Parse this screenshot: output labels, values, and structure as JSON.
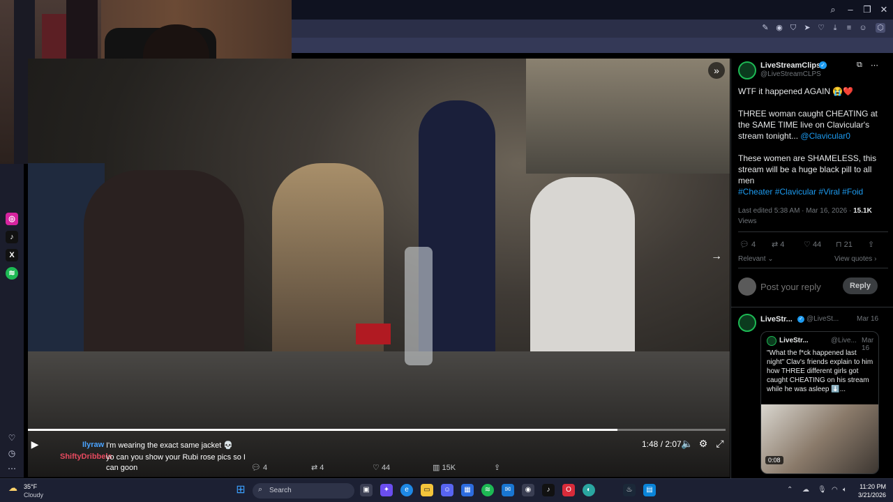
{
  "colors": {
    "accent_blue": "#1d9bf0",
    "progress": "#ffffff",
    "spotify_green": "#1db954"
  },
  "window_controls": {
    "search_icon": "search-icon",
    "minimize": "minimize-icon",
    "maximize": "maximize-icon",
    "close": "close-icon"
  },
  "video": {
    "time": "1:48 / 2:07",
    "progress": 0.845,
    "actions": {
      "replies": "4",
      "reposts": "4",
      "likes": "44",
      "views": "15K"
    }
  },
  "chat": [
    {
      "user": "Ilyraw",
      "user_color": "#4aa3ff",
      "message": "I'm wearing the exact same jacket 💀"
    },
    {
      "user": "ShiftyDribbels",
      "user_color": "#e84a5f",
      "message": "yo can you show your Rubi rose pics so I can goon"
    }
  ],
  "tweet": {
    "author_name": "LiveStreamClips",
    "author_handle": "@LiveStreamCLPS",
    "line1": "WTF it happened AGAIN 😭❤️",
    "para2": "THREE woman caught CHEATING at the SAME TIME live on Clavicular's stream tonight...",
    "mention": "@Clavicular0",
    "para3": "These women are SHAMELESS, this stream will be a huge black pill to all men",
    "hashtags": "#Cheater #Clavicular #Viral #Foid",
    "edited": "Last edited 5:38 AM · Mar 16, 2026 ·",
    "views_count": "15.1K",
    "views_label": "Views",
    "stats": {
      "replies": "4",
      "reposts": "4",
      "likes": "44",
      "bookmarks": "21"
    },
    "relevant": "Relevant",
    "view_quotes": "View quotes",
    "reply_placeholder": "Post your reply",
    "reply_button": "Reply"
  },
  "reply_tweet": {
    "name": "LiveStr...",
    "handle": "@LiveSt...",
    "date": "Mar 16",
    "quoted_name": "LiveStr...",
    "quoted_handle": "@Live...",
    "quoted_date": "Mar 16",
    "quoted_text": "\"What the f*ck happened last night\" Clav's friends explain to him how THREE different girls got caught CHEATING on his stream while he was asleep ⬇️...",
    "thumb_duration": "0:08"
  },
  "taskbar": {
    "weather_temp": "35°F",
    "weather_desc": "Cloudy",
    "search_placeholder": "Search",
    "time": "11:20 PM",
    "date": "3/21/2026"
  }
}
